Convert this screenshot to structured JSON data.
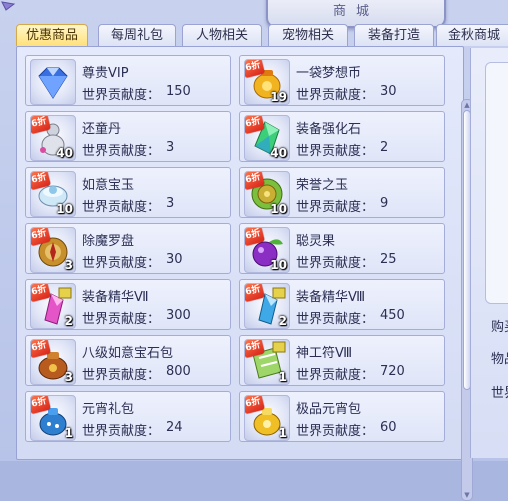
{
  "window": {
    "title": "商城"
  },
  "tabs": [
    {
      "label": "优惠商品",
      "active": true
    },
    {
      "label": "每周礼包",
      "active": false
    },
    {
      "label": "人物相关",
      "active": false
    },
    {
      "label": "宠物相关",
      "active": false
    },
    {
      "label": "装备打造",
      "active": false
    },
    {
      "label": "金秋商城",
      "active": false
    }
  ],
  "price_label": "世界贡献度：",
  "items": [
    {
      "name": "尊贵VIP",
      "price": "150",
      "count": "",
      "discount": "",
      "icon": "diamond-icon"
    },
    {
      "name": "一袋梦想币",
      "price": "30",
      "count": "19",
      "discount": "6折",
      "icon": "coin-bag-icon"
    },
    {
      "name": "还童丹",
      "price": "3",
      "count": "40",
      "discount": "6折",
      "icon": "potion-gourd-icon"
    },
    {
      "name": "装备强化石",
      "price": "2",
      "count": "40",
      "discount": "6折",
      "icon": "crystal-icon"
    },
    {
      "name": "如意宝玉",
      "price": "3",
      "count": "10",
      "discount": "6折",
      "icon": "jade-bowl-icon"
    },
    {
      "name": "荣誉之玉",
      "price": "9",
      "count": "10",
      "discount": "6折",
      "icon": "jade-disc-icon"
    },
    {
      "name": "除魔罗盘",
      "price": "30",
      "count": "3",
      "discount": "6折",
      "icon": "compass-icon"
    },
    {
      "name": "聪灵果",
      "price": "25",
      "count": "10",
      "discount": "6折",
      "icon": "purple-fruit-icon"
    },
    {
      "name": "装备精华Ⅶ",
      "price": "300",
      "count": "2",
      "discount": "6折",
      "icon": "essence-pink-icon"
    },
    {
      "name": "装备精华Ⅷ",
      "price": "450",
      "count": "2",
      "discount": "6折",
      "icon": "essence-blue-icon"
    },
    {
      "name": "八级如意宝石包",
      "price": "800",
      "count": "3",
      "discount": "6折",
      "icon": "gem-pouch-icon"
    },
    {
      "name": "神工符Ⅷ",
      "price": "720",
      "count": "1",
      "discount": "6折",
      "icon": "talisman-scroll-icon"
    },
    {
      "name": "元宵礼包",
      "price": "24",
      "count": "1",
      "discount": "6折",
      "icon": "lantern-bag-icon"
    },
    {
      "name": "极品元宵包",
      "price": "60",
      "count": "1",
      "discount": "6折",
      "icon": "gold-bag-icon"
    }
  ],
  "side": {
    "line1": "购买",
    "line2": "物品",
    "line3": "世界"
  },
  "colors": {
    "discount_badge": "#d8251a",
    "active_tab": "#ffe07a",
    "panel_bg": "#e4e9fb"
  }
}
